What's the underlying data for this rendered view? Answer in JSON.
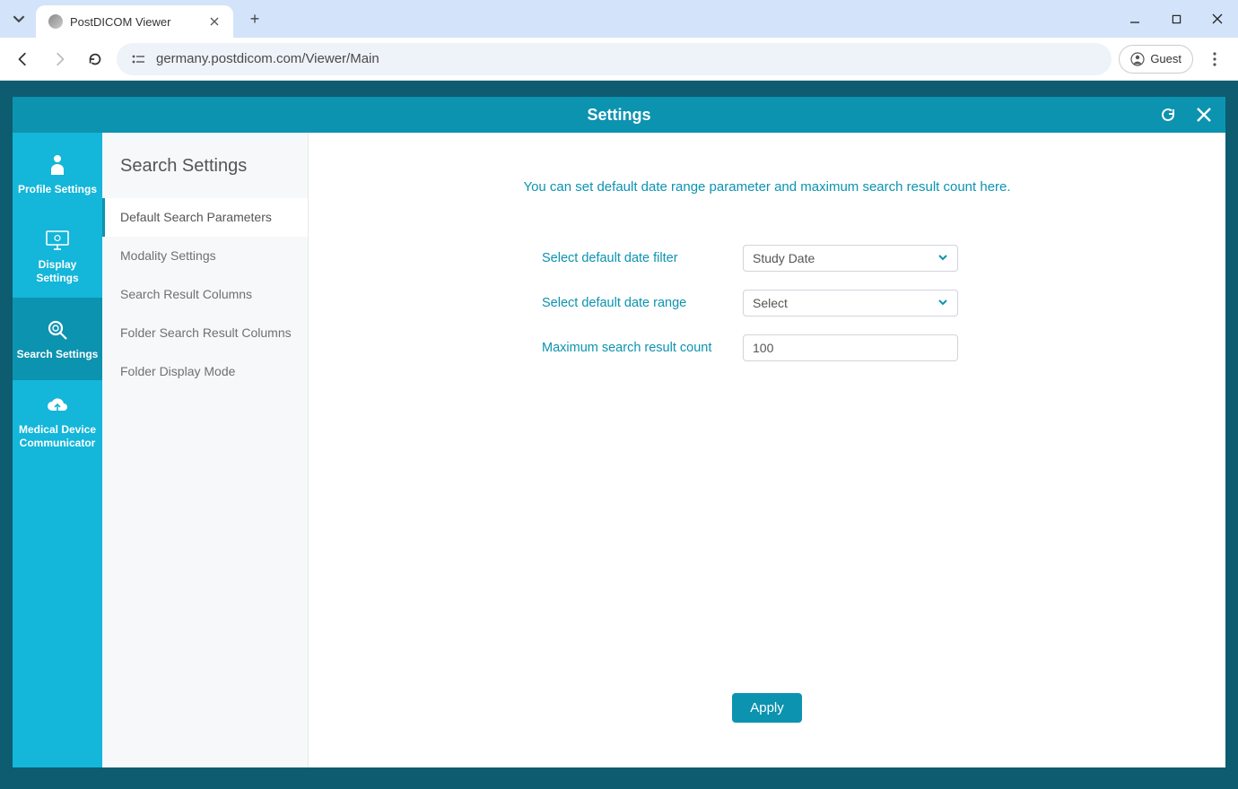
{
  "browser": {
    "tab_title": "PostDICOM Viewer",
    "url": "germany.postdicom.com/Viewer/Main",
    "guest_label": "Guest"
  },
  "modal": {
    "title": "Settings",
    "rail": [
      {
        "label": "Profile Settings"
      },
      {
        "label": "Display Settings"
      },
      {
        "label": "Search Settings"
      },
      {
        "label": "Medical Device Communicator"
      }
    ],
    "rail_active_index": 2,
    "section_title": "Search Settings",
    "subnav": [
      "Default Search Parameters",
      "Modality Settings",
      "Search Result Columns",
      "Folder Search Result Columns",
      "Folder Display Mode"
    ],
    "subnav_active_index": 0,
    "help_text": "You can set default date range parameter and maximum search result count here.",
    "form": {
      "date_filter_label": "Select default date filter",
      "date_filter_value": "Study Date",
      "date_range_label": "Select default date range",
      "date_range_value": "Select",
      "max_count_label": "Maximum search result count",
      "max_count_value": "100"
    },
    "apply_label": "Apply"
  }
}
